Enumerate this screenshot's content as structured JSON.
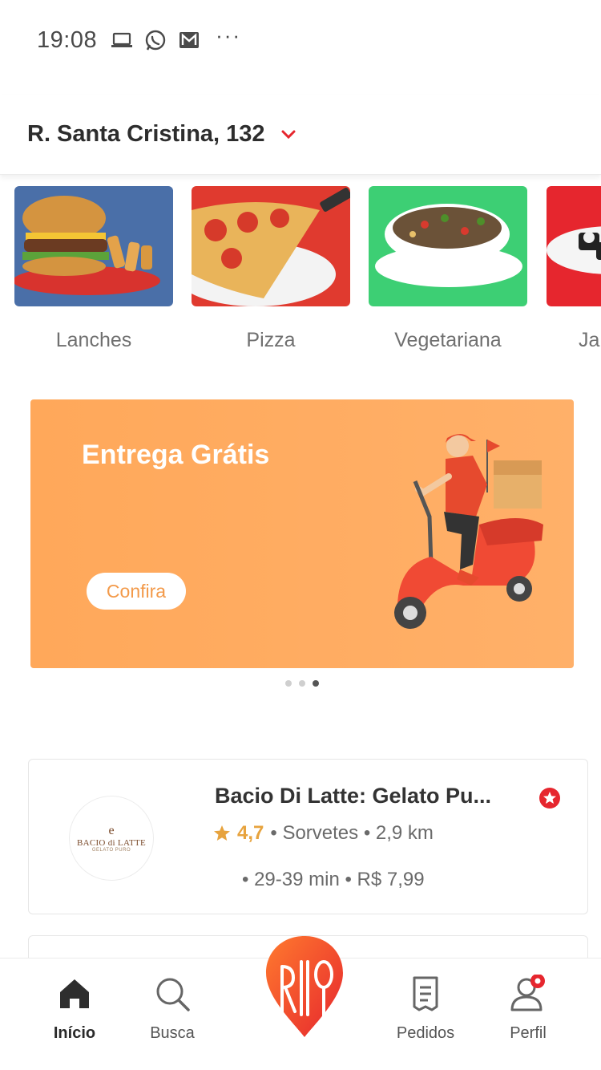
{
  "status_bar": {
    "time": "19:08",
    "icons": [
      "laptop-icon",
      "whatsapp-icon",
      "mail-icon"
    ],
    "more": "···"
  },
  "address": {
    "text": "R. Santa Cristina, 132",
    "chevron": "chevron-down-icon"
  },
  "categories": [
    {
      "label": "Lanches"
    },
    {
      "label": "Pizza"
    },
    {
      "label": "Vegetariana"
    },
    {
      "label": "Ja"
    }
  ],
  "banner": {
    "title": "Entrega Grátis",
    "button": "Confira",
    "pager_total": 3,
    "pager_active": 3
  },
  "restaurant": {
    "logo_mark": "e",
    "logo_name": "BACIO di LATTE",
    "logo_sub": "GELATO PURO",
    "name": "Bacio Di Latte: Gelato Pu...",
    "rating": "4,7",
    "category": "• Sorvetes • 2,9 km",
    "delivery": "• 29-39 min • R$ 7,99"
  },
  "bottom_nav": {
    "items": [
      {
        "label": "Início",
        "icon": "home-icon",
        "active": true
      },
      {
        "label": "Busca",
        "icon": "search-icon",
        "active": false
      },
      {
        "label": "Pedidos",
        "icon": "orders-icon",
        "active": false
      },
      {
        "label": "Perfil",
        "icon": "profile-icon",
        "active": false
      }
    ]
  },
  "colors": {
    "brand_red": "#e6262e",
    "banner_orange": "#ffa85a",
    "rating_gold": "#e7a33e"
  }
}
